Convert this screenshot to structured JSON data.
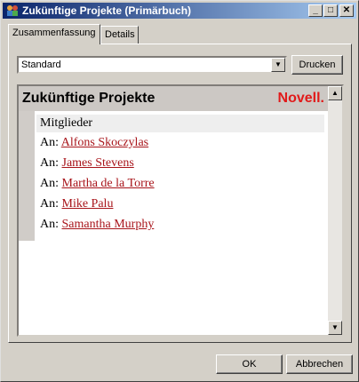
{
  "window": {
    "title": "Zukünftige Projekte (Primärbuch)",
    "icons": {
      "app": "users-icon",
      "minimize": "minimize-icon",
      "maximize": "maximize-icon",
      "close": "close-icon"
    }
  },
  "tabs": [
    {
      "label": "Zusammenfassung",
      "active": true
    },
    {
      "label": "Details",
      "active": false
    }
  ],
  "view_select": {
    "value": "Standard"
  },
  "print_button": {
    "label": "Drucken"
  },
  "summary": {
    "title": "Zukünftige Projekte",
    "brand": "Novell.",
    "section_header": "Mitglieder",
    "prefix": "An: ",
    "members": [
      "Alfons Skoczylas",
      "James Stevens",
      "Martha de la Torre",
      "Mike Palu",
      "Samantha Murphy"
    ],
    "link_color": "#a8141a"
  },
  "footer": {
    "ok_label": "OK",
    "cancel_label": "Abbrechen"
  }
}
